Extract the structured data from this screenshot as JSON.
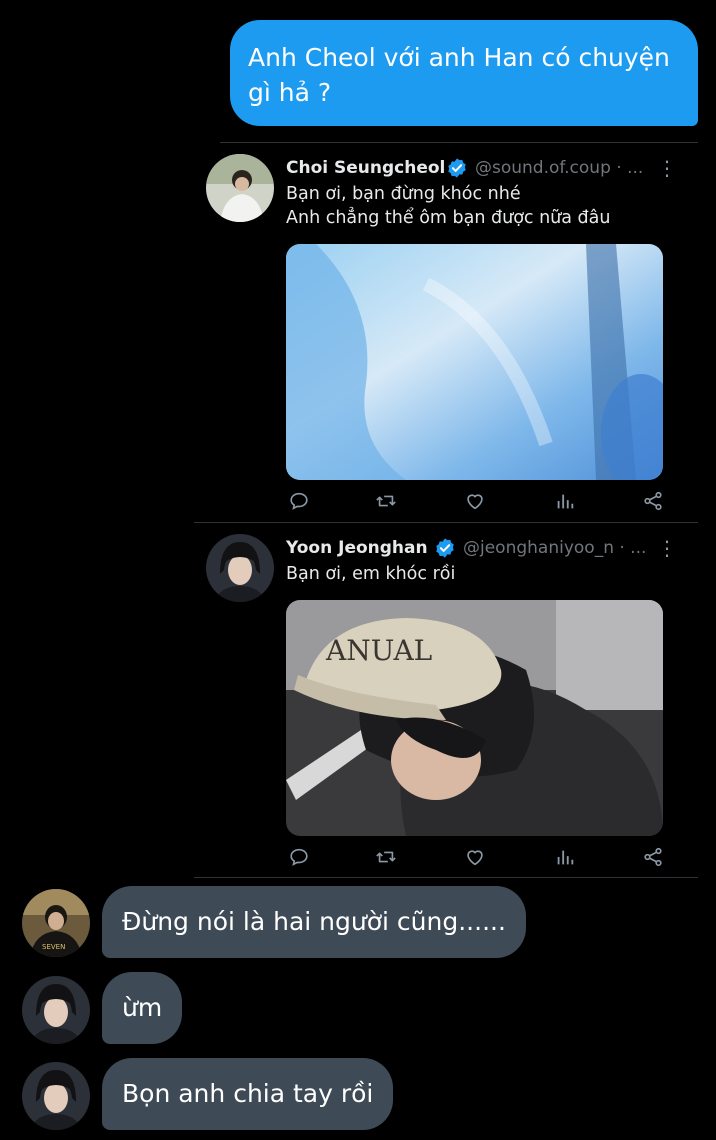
{
  "outgoing_message": {
    "text": "Anh Cheol với anh Han có chuyện gì hả ?",
    "color": "#1d9bf0"
  },
  "tweets": [
    {
      "name": "Choi Seungcheol",
      "handle": "@sound.of.coup · ...",
      "lines": [
        "Bạn ơi, bạn đừng khóc nhé",
        "Anh chẳng thể ôm bạn được nữa đâu"
      ],
      "more": "⋮",
      "verified_icon": "verified-badge-icon",
      "actions": [
        "reply-icon",
        "retweet-icon",
        "like-icon",
        "views-icon",
        "share-icon"
      ]
    },
    {
      "name": "Yoon Jeonghan",
      "handle": "@jeonghaniyoo_n · ...",
      "lines": [
        "Bạn ơi, em khóc rồi"
      ],
      "more": "⋮",
      "verified_icon": "verified-badge-icon",
      "actions": [
        "reply-icon",
        "retweet-icon",
        "like-icon",
        "views-icon",
        "share-icon"
      ]
    }
  ],
  "incoming_messages": [
    {
      "text": "Đừng nói là hai người cũng......"
    },
    {
      "text": "ừm"
    },
    {
      "text": "Bọn anh chia tay rồi"
    }
  ],
  "colors": {
    "background": "#000000",
    "incoming_bubble": "#3e4a55",
    "verified": "#1d9bf0",
    "muted": "#71767b"
  }
}
